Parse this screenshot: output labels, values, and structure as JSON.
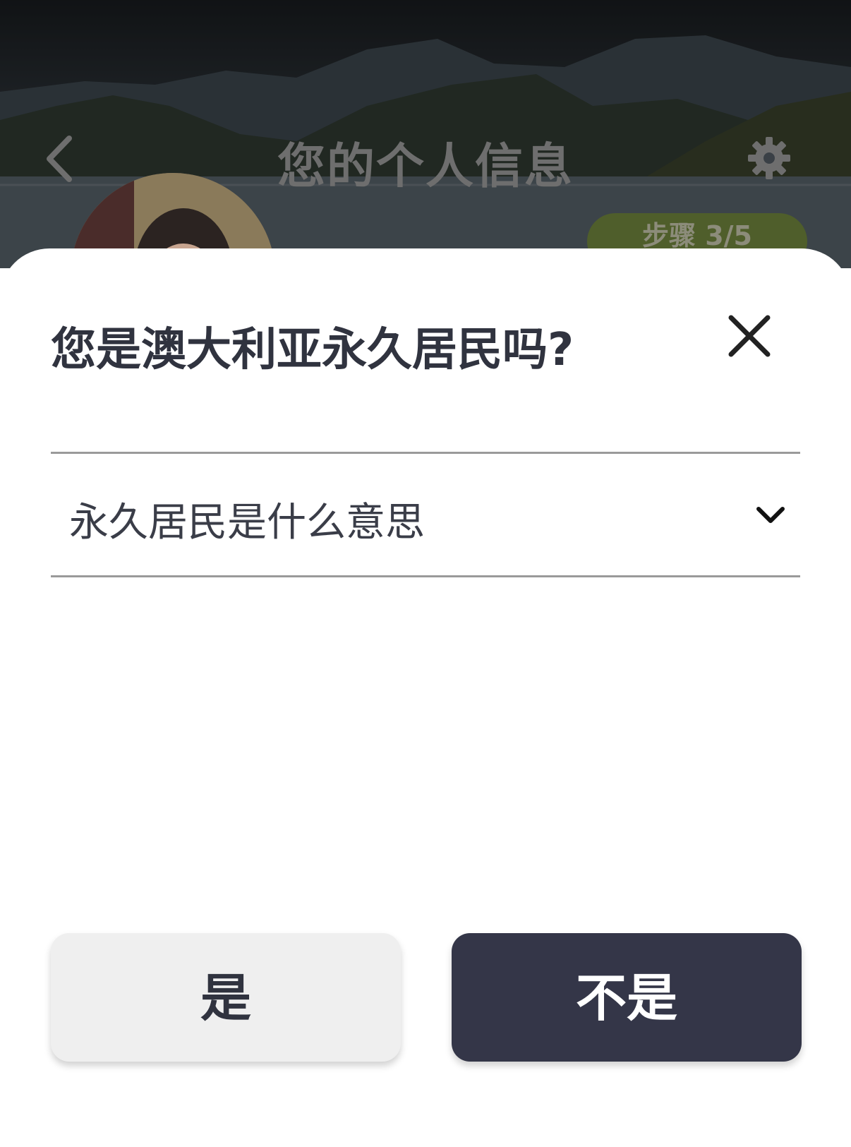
{
  "header": {
    "title": "您的个人信息",
    "step_badge": "步骤 3/5",
    "back_icon": "chevron-left-icon",
    "settings_icon": "gear-icon",
    "badge_color": "#4f5e2b"
  },
  "dialog": {
    "question": "您是澳大利亚永久居民吗?",
    "close_icon": "close-icon",
    "accordion": {
      "label": "永久居民是什么意思",
      "icon": "chevron-down-icon"
    },
    "buttons": {
      "yes_label": "是",
      "no_label": "不是"
    },
    "colors": {
      "primary_button": "#343648",
      "secondary_button": "#efefef",
      "text": "#30333f"
    }
  }
}
